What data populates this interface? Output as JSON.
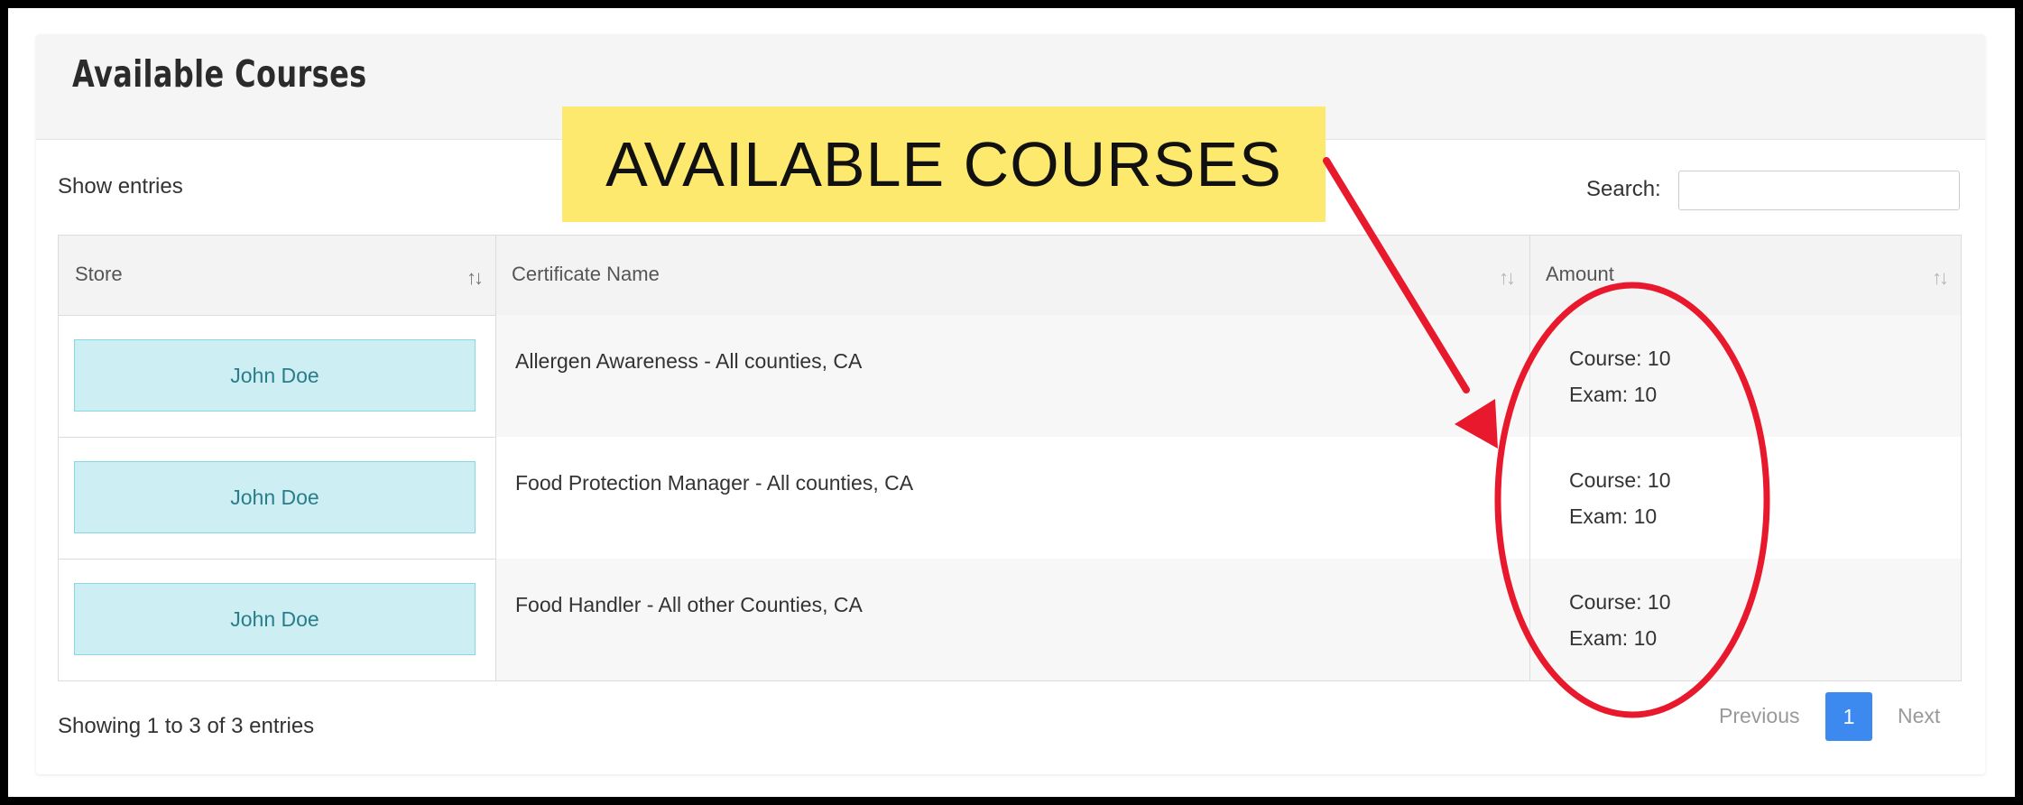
{
  "panel": {
    "title": "Available Courses"
  },
  "controls": {
    "show_entries": "Show entries",
    "search_label": "Search:",
    "search_value": ""
  },
  "table": {
    "columns": [
      "Store",
      "Certificate Name",
      "Amount"
    ],
    "sort_glyph": "↑↓",
    "rows": [
      {
        "store": "John Doe",
        "certificate": "Allergen Awareness - All counties, CA",
        "course": "Course: 10",
        "exam": "Exam: 10"
      },
      {
        "store": "John Doe",
        "certificate": "Food Protection Manager - All counties, CA",
        "course": "Course: 10",
        "exam": "Exam: 10"
      },
      {
        "store": "John Doe",
        "certificate": "Food Handler - All other Counties, CA",
        "course": "Course: 10",
        "exam": "Exam: 10"
      }
    ]
  },
  "footer": {
    "showing": "Showing 1 to 3 of 3 entries",
    "previous": "Previous",
    "page": "1",
    "next": "Next"
  },
  "annotation": {
    "callout_text": "AVAILABLE COURSES",
    "callout_color": "#fde96e",
    "arrow_color": "#e8192c"
  }
}
